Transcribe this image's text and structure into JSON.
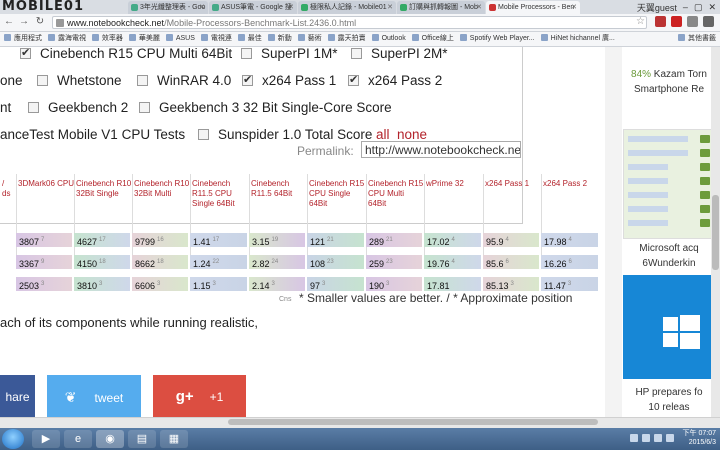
{
  "browser": {
    "logo_text": "MOBILE01",
    "tabs": [
      {
        "label": "3年光纖整理表 - Goo",
        "active": false
      },
      {
        "label": "ASUS筆電 - Google 搜",
        "active": false
      },
      {
        "label": "極限私人記錄 - Mobile01",
        "active": false
      },
      {
        "label": "訂購與抓轉報圖 - Mob",
        "active": false
      },
      {
        "label": "Mobile Processors - Ben",
        "active": true
      }
    ],
    "user": "天翼guest",
    "address_host": "www.notebookcheck.net",
    "address_path": "/Mobile-Processors-Benchmark-List.2436.0.html",
    "bookmarks": [
      "應用程式",
      "露海電視",
      "效率器",
      "華美麗",
      "ASUS",
      "電視連",
      "最佳",
      "新動",
      "藝術",
      "露天拍賣",
      "Outlook",
      "Office線上",
      "Spotify Web Player...",
      "HiNet hichannel 廣..."
    ],
    "other_bookmarks": "其他書籤"
  },
  "filters": {
    "row1": [
      {
        "label": "Cinebench R15 CPU Multi 64Bit",
        "checked": true
      },
      {
        "label": "SuperPI 1M*",
        "checked": false
      },
      {
        "label": "SuperPI 2M*",
        "checked": false
      }
    ],
    "row2": [
      {
        "label": "one",
        "checked": null
      },
      {
        "label": "Whetstone",
        "checked": false
      },
      {
        "label": "WinRAR 4.0",
        "checked": false
      },
      {
        "label": "x264 Pass 1",
        "checked": true
      },
      {
        "label": "x264 Pass 2",
        "checked": true
      }
    ],
    "row3": [
      {
        "label": "nt",
        "checked": null
      },
      {
        "label": "Geekbench 2",
        "checked": false
      },
      {
        "label": "Geekbench 3 32 Bit Single-Core Score",
        "checked": false
      }
    ],
    "row4": [
      {
        "label": "anceTest Mobile V1 CPU Tests",
        "checked": null
      },
      {
        "label": "Sunspider 1.0 Total Score",
        "checked": false
      }
    ],
    "all_link": "all",
    "none_link": "none",
    "permalink_label": "Permalink:",
    "permalink_value": "http://www.notebookcheck.net/"
  },
  "table": {
    "headers": [
      "/\nds",
      "3DMark06 CPU",
      "Cinebench R10 32Bit Single",
      "Cinebench R10 32Bit Multi",
      "Cinebench R11.5 CPU Single 64Bit",
      "Cinebench R11.5 64Bit",
      "Cinebench R15 CPU Single 64Bit",
      "Cinebench R15 CPU Multi 64Bit",
      "wPrime 32",
      "x264 Pass 1",
      "x264 Pass 2"
    ],
    "rows": [
      [
        [
          "",
          ""
        ],
        [
          "3807",
          "7"
        ],
        [
          "4627",
          "17"
        ],
        [
          "9799",
          "16"
        ],
        [
          "1.41",
          "17"
        ],
        [
          "3.15",
          "19"
        ],
        [
          "121",
          "21"
        ],
        [
          "289",
          "21"
        ],
        [
          "17.02",
          "4"
        ],
        [
          "95.9",
          "4"
        ],
        [
          "17.98",
          "4"
        ]
      ],
      [
        [
          "",
          ""
        ],
        [
          "3367",
          "9"
        ],
        [
          "4150",
          "18"
        ],
        [
          "8662",
          "18"
        ],
        [
          "1.24",
          "22"
        ],
        [
          "2.82",
          "24"
        ],
        [
          "108",
          "23"
        ],
        [
          "259",
          "23"
        ],
        [
          "19.76",
          "4"
        ],
        [
          "85.6",
          "6"
        ],
        [
          "16.26",
          "6"
        ]
      ],
      [
        [
          "",
          ""
        ],
        [
          "2503",
          "3"
        ],
        [
          "3810",
          "3"
        ],
        [
          "6606",
          "3"
        ],
        [
          "1.15",
          "3"
        ],
        [
          "2.14",
          "3"
        ],
        [
          "97",
          "3"
        ],
        [
          "190",
          "3"
        ],
        [
          "17.81",
          ""
        ],
        [
          "85.13",
          "3"
        ],
        [
          "11.47",
          "3"
        ]
      ]
    ],
    "footnote_small": "Cns",
    "footnote": "* Smaller values are better. / * Approximate position"
  },
  "description": "ach of its components while running realistic,",
  "share": {
    "facebook": "hare",
    "twitter": "tweet",
    "gplus_icon": "g+",
    "gplus_count": "+1"
  },
  "sidebar": {
    "item1_pct": "84%",
    "item1_title": " Kazam Torn",
    "item1_sub": "Smartphone Re",
    "item2_line1": "Microsoft acq",
    "item2_line2": "6Wunderkin",
    "item3_line1": "HP prepares fo",
    "item3_line2": "10 releas"
  },
  "taskbar": {
    "time": "下午 07:07",
    "date": "2015/6/3"
  },
  "colors": {
    "accent_red": "#b3232b",
    "facebook": "#3b5998",
    "twitter": "#55acee",
    "gplus": "#dc4e41",
    "windows_blue": "#1787d6"
  }
}
